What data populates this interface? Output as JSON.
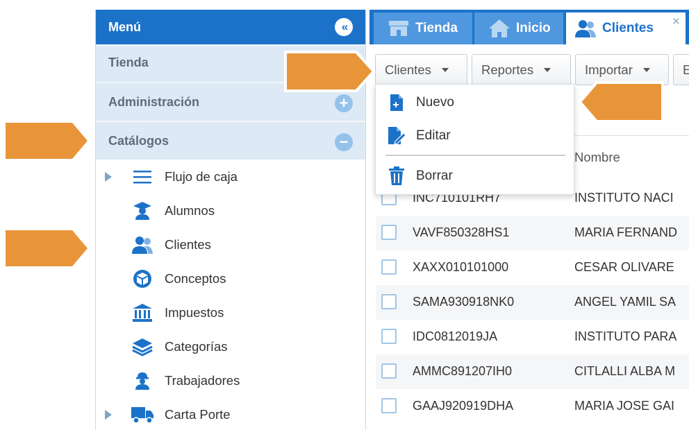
{
  "colors": {
    "primary": "#1c72c8",
    "tab_inactive": "#4f97df",
    "section_bg": "#dde9f4",
    "arrow": "#e8953a"
  },
  "sidebar": {
    "title": "Menú",
    "collapse_icon": "double-chevron-left-icon",
    "sections": [
      {
        "label": "Tienda"
      },
      {
        "label": "Administración",
        "icon": "plus-circle-icon"
      },
      {
        "label": "Catálogos",
        "icon": "minus-circle-icon"
      }
    ],
    "items": [
      {
        "label": "Flujo de caja",
        "icon": "list-icon",
        "expandable": true
      },
      {
        "label": "Alumnos",
        "icon": "graduate-icon"
      },
      {
        "label": "Clientes",
        "icon": "users-icon"
      },
      {
        "label": "Conceptos",
        "icon": "cube-icon"
      },
      {
        "label": "Impuestos",
        "icon": "bank-icon"
      },
      {
        "label": "Categorías",
        "icon": "layers-icon"
      },
      {
        "label": "Trabajadores",
        "icon": "worker-icon"
      },
      {
        "label": "Carta Porte",
        "icon": "truck-icon",
        "expandable": true
      }
    ]
  },
  "tabs": [
    {
      "label": "Tienda",
      "icon": "store-icon",
      "active": false
    },
    {
      "label": "Inicio",
      "icon": "home-icon",
      "active": false
    },
    {
      "label": "Clientes",
      "icon": "users-icon",
      "active": true,
      "close": "×"
    }
  ],
  "toolbar": {
    "buttons": [
      {
        "label": "Clientes"
      },
      {
        "label": "Reportes"
      },
      {
        "label": "Importar"
      },
      {
        "label": "E"
      }
    ]
  },
  "dropdown": {
    "items": [
      {
        "label": "Nuevo",
        "icon": "new-document-icon"
      },
      {
        "label": "Editar",
        "icon": "edit-document-icon"
      },
      {
        "label": "Borrar",
        "icon": "trash-icon"
      }
    ]
  },
  "table": {
    "header_name": "Nombre",
    "rows": [
      {
        "rfc": "INC710101RH7",
        "nombre": "INSTITUTO NACI"
      },
      {
        "rfc": "VAVF850328HS1",
        "nombre": "MARIA FERNAND"
      },
      {
        "rfc": "XAXX010101000",
        "nombre": "CESAR OLIVARE"
      },
      {
        "rfc": "SAMA930918NK0",
        "nombre": "ANGEL YAMIL SA"
      },
      {
        "rfc": "IDC0812019JA",
        "nombre": "INSTITUTO PARA"
      },
      {
        "rfc": "AMMC891207IH0",
        "nombre": "CITLALLI ALBA M"
      },
      {
        "rfc": "GAAJ920919DHA",
        "nombre": "MARIA JOSE GAI"
      }
    ]
  }
}
